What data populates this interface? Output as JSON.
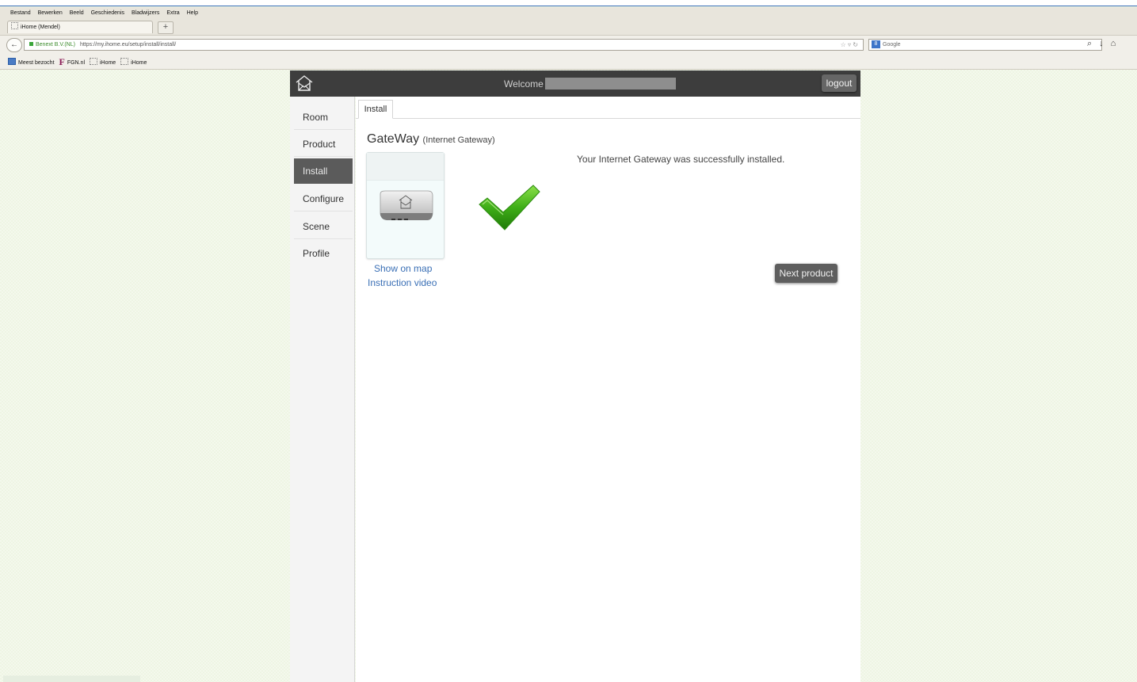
{
  "browser": {
    "menu": [
      "Bestand",
      "Bewerken",
      "Beeld",
      "Geschiedenis",
      "Bladwijzers",
      "Extra",
      "Help"
    ],
    "tab_title": "iHome (Mendel)",
    "new_tab": "+",
    "identity": "Benext B.V.(NL)",
    "url": "https://my.ihome.eu/setup/install/install/",
    "search_engine": "8",
    "search_placeholder": "Google",
    "bookmarks": [
      "Meest bezocht",
      "FGN.nl",
      "iHome",
      "iHome"
    ],
    "bookmark_fgn_letter": "F"
  },
  "app": {
    "welcome": "Welcome",
    "logout": "logout",
    "nav": [
      "Room",
      "Product",
      "Install",
      "Configure",
      "Scene",
      "Profile"
    ],
    "active_nav": "Install",
    "tab": "Install",
    "device_name": "GateWay",
    "device_type": "(Internet Gateway)",
    "show_on_map": "Show on map",
    "instruction_video": "Instruction video",
    "message": "Your Internet Gateway was successfully installed.",
    "next_product": "Next product"
  },
  "colors": {
    "header_bg": "#3d3d3d",
    "active_nav_bg": "#5b5b5b",
    "link": "#3a6fb5",
    "check_green": "#3fae18",
    "page_bg": "#eef5e3"
  }
}
